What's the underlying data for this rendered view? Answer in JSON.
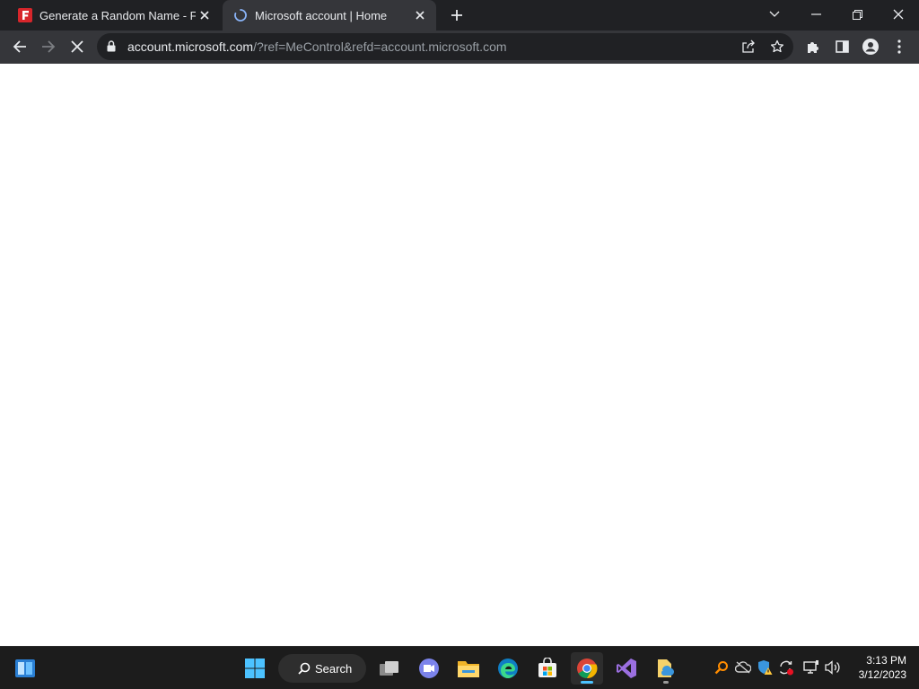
{
  "browser": {
    "tabs": [
      {
        "title": "Generate a Random Name - Fake",
        "favicon": "fakename-f-icon",
        "active": false
      },
      {
        "title": "Microsoft account | Home",
        "favicon": "loading-spinner-icon",
        "active": true
      }
    ],
    "new_tab_icon": "plus-icon",
    "address_bar": {
      "host": "account.microsoft.com",
      "path": "/?ref=MeControl&refd=account.microsoft.com"
    },
    "colors": {
      "tabstrip": "#202124",
      "toolbar": "#35363a",
      "omnibox": "#202124",
      "text": "#e8eaed",
      "dim_text": "#9aa0a6"
    }
  },
  "taskbar": {
    "search_label": "Search",
    "pinned_apps": [
      "task-view-icon",
      "teams-chat-icon",
      "file-explorer-icon",
      "edge-icon",
      "store-icon",
      "chrome-icon",
      "visual-studio-icon",
      "azure-data-studio-icon"
    ],
    "active_app": "chrome-icon",
    "clock": {
      "time": "3:13 PM",
      "date": "3/12/2023"
    },
    "tray_icons": [
      "search-tool-icon",
      "onedrive-offline-icon",
      "defender-warning-icon",
      "sync-error-icon",
      "network-icon",
      "volume-icon"
    ]
  }
}
